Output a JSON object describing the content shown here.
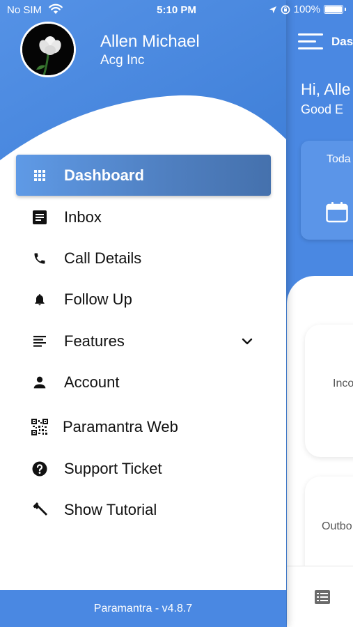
{
  "status_bar": {
    "carrier": "No SIM",
    "time": "5:10 PM",
    "battery": "100%"
  },
  "drawer": {
    "user_name": "Allen Michael",
    "company": "Acg Inc",
    "menu": [
      {
        "label": "Dashboard",
        "icon": "grid-icon",
        "active": true
      },
      {
        "label": "Inbox",
        "icon": "inbox-icon",
        "active": false
      },
      {
        "label": "Call Details",
        "icon": "phone-icon",
        "active": false
      },
      {
        "label": "Follow Up",
        "icon": "bell-icon",
        "active": false
      },
      {
        "label": "Features",
        "icon": "list-icon",
        "active": false,
        "expandable": true
      },
      {
        "label": "Account",
        "icon": "person-icon",
        "active": false
      },
      {
        "label": "Paramantra Web",
        "icon": "qr-code-icon",
        "active": false
      },
      {
        "label": "Support Ticket",
        "icon": "help-icon",
        "active": false
      },
      {
        "label": "Show Tutorial",
        "icon": "hammer-icon",
        "active": false
      }
    ],
    "footer": "Paramantra - v4.8.7"
  },
  "background": {
    "header_title": "Das",
    "greeting": "Hi, Alle",
    "greeting_sub": "Good E",
    "today_label": "Toda",
    "card1_label": "Inco",
    "card2_label": "Outbo"
  },
  "colors": {
    "primary": "#4a88e2",
    "active_item": "#5584c6",
    "text": "#111111"
  }
}
